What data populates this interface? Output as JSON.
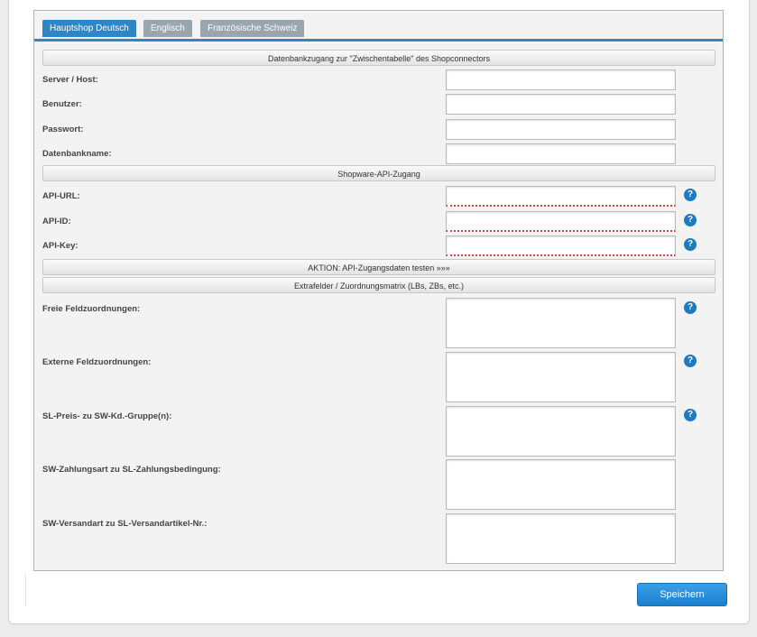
{
  "tabs": [
    {
      "label": "Hauptshop Deutsch",
      "active": true
    },
    {
      "label": "Englisch",
      "active": false
    },
    {
      "label": "Französische Schweiz",
      "active": false
    }
  ],
  "sections": {
    "db": "Datenbankzugang zur \"Zwischentabelle\" des Shopconnectors",
    "api": "Shopware-API-Zugang",
    "action": "AKTION: API-Zugangsdaten testen »»»",
    "extra": "Extrafelder / Zuordnungsmatrix (LBs, ZBs, etc.)"
  },
  "fields": {
    "server": {
      "label": "Server / Host:",
      "value": ""
    },
    "user": {
      "label": "Benutzer:",
      "value": ""
    },
    "password": {
      "label": "Passwort:",
      "value": ""
    },
    "dbname": {
      "label": "Datenbankname:",
      "value": ""
    },
    "api_url": {
      "label": "API-URL:",
      "value": ""
    },
    "api_id": {
      "label": "API-ID:",
      "value": ""
    },
    "api_key": {
      "label": "API-Key:",
      "value": ""
    },
    "free_mapping": {
      "label": "Freie Feldzuordnungen:",
      "value": ""
    },
    "external_mapping": {
      "label": "Externe Feldzuordnungen:",
      "value": ""
    },
    "price_group": {
      "label": "SL-Preis- zu SW-Kd.-Gruppe(n):",
      "value": ""
    },
    "payment_mapping": {
      "label": "SW-Zahlungsart zu SL-Zahlungsbedingung:",
      "value": ""
    },
    "shipping_mapping": {
      "label": "SW-Versandart zu SL-Versandartikel-Nr.:",
      "value": ""
    }
  },
  "help_glyph": "?",
  "buttons": {
    "save": "Speichern"
  },
  "colors": {
    "accent": "#2f86c4",
    "tab_inactive": "#9aa6ae",
    "help": "#1f7bc0",
    "invalid_underline": "#e04545"
  }
}
